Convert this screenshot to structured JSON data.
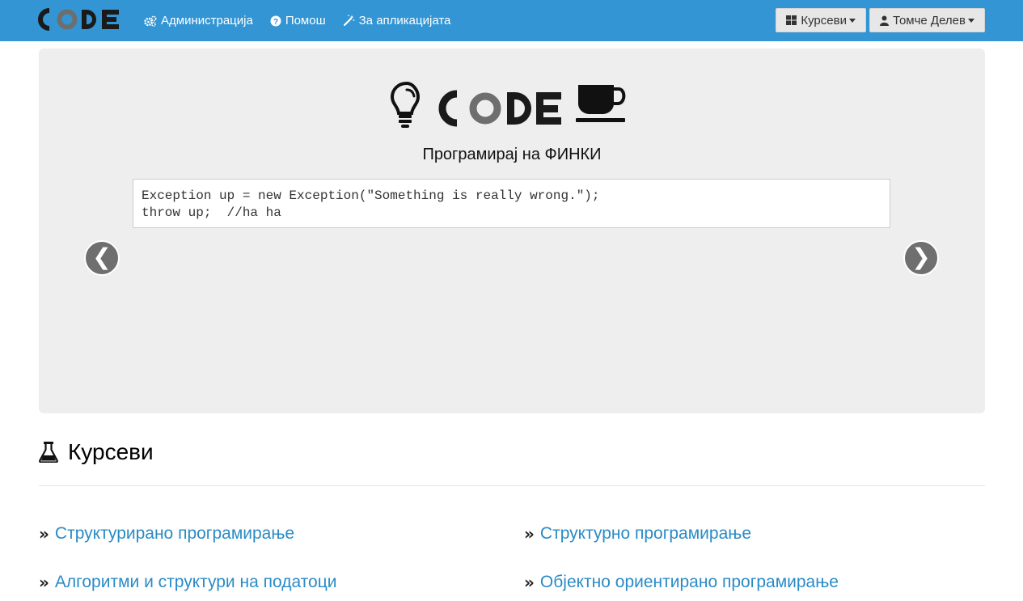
{
  "navbar": {
    "brand": "CODE",
    "links": [
      {
        "label": "Администрација",
        "icon": "cogs-icon"
      },
      {
        "label": "Помош",
        "icon": "question-circle-icon"
      },
      {
        "label": "За апликацијата",
        "icon": "magic-wand-icon"
      }
    ],
    "courses_menu": {
      "label": "Курсеви",
      "icon": "grid-icon"
    },
    "user_menu": {
      "label": "Томче Делев",
      "icon": "user-icon"
    },
    "colors": {
      "bar": "#3395d3",
      "text": "#ffffff"
    }
  },
  "carousel": {
    "logo_text": "CODE",
    "tagline": "Програмирај на ФИНКИ",
    "code_lines": [
      "Exception up = new Exception(\"Something is really wrong.\");",
      "throw up;  //ha ha"
    ],
    "prev_label": "❮",
    "next_label": "❯"
  },
  "courses": {
    "heading": "Курсеви",
    "heading_icon": "flask-icon",
    "items": [
      {
        "label": "Структурирано програмирање"
      },
      {
        "label": "Структурно програмирање"
      },
      {
        "label": "Алгоритми и структури на податоци"
      },
      {
        "label": "Објектно ориентирано програмирање"
      }
    ],
    "link_color": "#2a8bc7"
  }
}
